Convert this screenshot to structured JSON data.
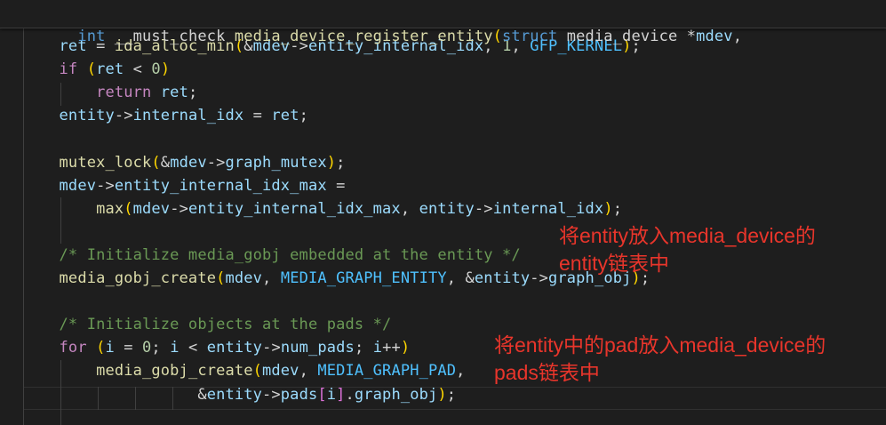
{
  "signature": {
    "t1": "int",
    "t2": " ",
    "t3": "__must_check",
    "t4": " ",
    "t5": "media_device_register_entity",
    "t6": "(",
    "t7": "struct",
    "t8": " ",
    "t9": "media_device",
    "t10": " *",
    "t11": "mdev",
    "t12": ","
  },
  "code": [
    [
      "    ",
      "ret",
      " = ",
      "ida_alloc_min",
      "(",
      "&",
      "mdev",
      "->",
      "entity_internal_idx",
      ", ",
      "1",
      ", ",
      "GFP_KERNEL",
      ")",
      ";"
    ],
    [
      "    ",
      "if",
      " ",
      "(",
      "ret",
      " < ",
      "0",
      ")"
    ],
    [
      "        ",
      "return",
      " ",
      "ret",
      ";"
    ],
    [
      "    ",
      "entity",
      "->",
      "internal_idx",
      " = ",
      "ret",
      ";"
    ],
    [
      ""
    ],
    [
      "    ",
      "mutex_lock",
      "(",
      "&",
      "mdev",
      "->",
      "graph_mutex",
      ")",
      ";"
    ],
    [
      "    ",
      "mdev",
      "->",
      "entity_internal_idx_max",
      " ="
    ],
    [
      "        ",
      "max",
      "(",
      "mdev",
      "->",
      "entity_internal_idx_max",
      ", ",
      "entity",
      "->",
      "internal_idx",
      ")",
      ";"
    ],
    [
      ""
    ],
    [
      "    ",
      "/* Initialize media_gobj embedded at the entity */"
    ],
    [
      "    ",
      "media_gobj_create",
      "(",
      "mdev",
      ", ",
      "MEDIA_GRAPH_ENTITY",
      ", ",
      "&",
      "entity",
      "->",
      "graph_obj",
      ")",
      ";"
    ],
    [
      ""
    ],
    [
      "    ",
      "/* Initialize objects at the pads */"
    ],
    [
      "    ",
      "for",
      " ",
      "(",
      "i",
      " = ",
      "0",
      "; ",
      "i",
      " < ",
      "entity",
      "->",
      "num_pads",
      "; ",
      "i",
      "++",
      ")"
    ],
    [
      "        ",
      "media_gobj_create",
      "(",
      "mdev",
      ", ",
      "MEDIA_GRAPH_PAD",
      ","
    ],
    [
      "                   ",
      "&",
      "entity",
      "->",
      "pads",
      "[",
      "i",
      "]",
      ".",
      "graph_obj",
      ")",
      ";"
    ]
  ],
  "annotations": {
    "entity_note_line1": "将entity放入media_device的",
    "entity_note_line2": "entity链表中",
    "pads_note_line1": "将entity中的pad放入media_device的",
    "pads_note_line2": "pads链表中"
  }
}
